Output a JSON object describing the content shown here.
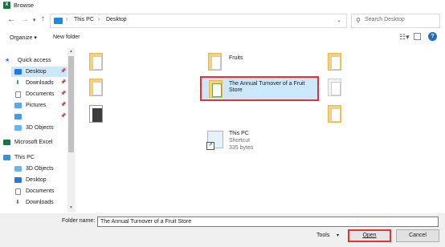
{
  "window": {
    "title": "Browse",
    "app_icon_letter": "X"
  },
  "address": {
    "crumbs": [
      "This PC",
      "Desktop"
    ],
    "separator": "›",
    "dropdown_icon": "chevron-down-icon"
  },
  "search": {
    "placeholder": "Search Desktop",
    "icon": "search-icon"
  },
  "toolbar": {
    "organize_label": "Organize ▾",
    "new_folder_label": "New folder"
  },
  "nav": {
    "items": [
      {
        "label": "Quick access",
        "icon": "star-icon"
      },
      {
        "label": "Desktop",
        "icon": "desktop-icon",
        "pinned": true
      },
      {
        "label": "Downloads",
        "icon": "download-icon",
        "pinned": true
      },
      {
        "label": "Documents",
        "icon": "documents-icon",
        "pinned": true
      },
      {
        "label": "Pictures",
        "icon": "pictures-icon",
        "pinned": true
      },
      {
        "label": "",
        "icon": "monitor-icon",
        "pinned": true
      },
      {
        "label": "3D Objects",
        "icon": "cube-icon"
      },
      {
        "label": "Microsoft Excel",
        "icon": "excel-icon"
      },
      {
        "label": "This PC",
        "icon": "computer-icon"
      },
      {
        "label": "3D Objects",
        "icon": "cube-icon"
      },
      {
        "label": "Desktop",
        "icon": "desktop-icon"
      },
      {
        "label": "Documents",
        "icon": "documents-icon"
      },
      {
        "label": "Downloads",
        "icon": "download-icon"
      }
    ]
  },
  "files": {
    "fruits": "Fruits",
    "selected_name": "The Annual Turnover of a Fruit Store",
    "thispc_name": "This PC",
    "thispc_type": "Shortcut",
    "thispc_size": "335 bytes"
  },
  "footer": {
    "folder_name_label": "Folder name:",
    "folder_name_value": "The Annual Turnover of a Fruit Store",
    "tools_label": "Tools",
    "open_label": "Open",
    "cancel_label": "Cancel"
  },
  "colors": {
    "selection": "#cce8ff",
    "highlight": "#e23232",
    "folder": "#f6d27a"
  }
}
